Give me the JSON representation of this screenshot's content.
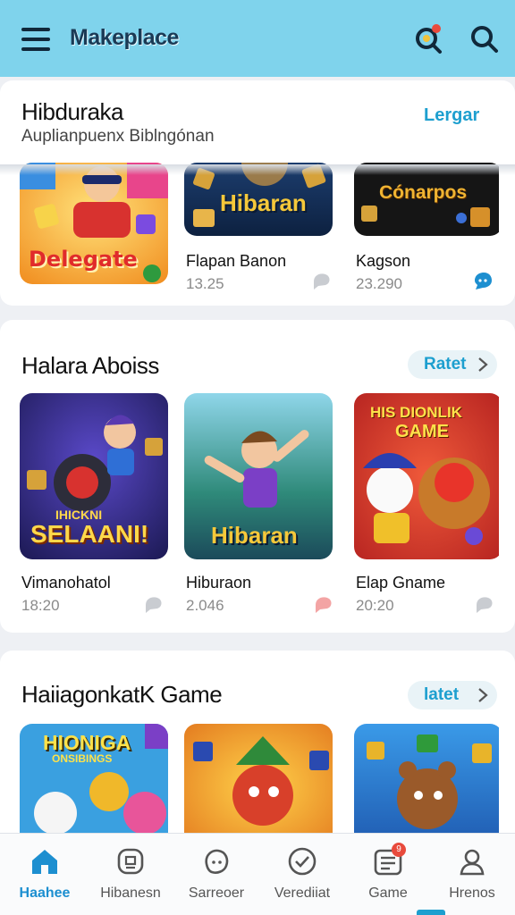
{
  "app": {
    "title": "Makeplace"
  },
  "colors": {
    "header": "#7fd3ec",
    "accent": "#1d9fcf",
    "nav_active": "#1d8fd0"
  },
  "header": {
    "icons": [
      "menu-icon",
      "filter-search-icon",
      "search-icon"
    ],
    "notification_dot_color": "#e84a3c"
  },
  "section1": {
    "title": "Hibduraka",
    "subtitle": "Auplianpuenx Biblngónan",
    "action": "Lergar",
    "items": [
      {
        "tile_text": "Delegate",
        "name": "",
        "value": ""
      },
      {
        "tile_text": "Hibaran",
        "name": "Flapan Banon",
        "value": "13.25"
      },
      {
        "tile_text": "Cónarpos",
        "name": "Kagson",
        "value": "23.290"
      }
    ]
  },
  "section2": {
    "title": "Halara Aboiss",
    "action": "Ratet",
    "items": [
      {
        "tile_text": "SELAANI!",
        "tile_text_top": "IHICKNI",
        "name": "Vimanohatol",
        "value": "18:20"
      },
      {
        "tile_text": "Hibaran",
        "name": "Hiburaon",
        "value": "2.046"
      },
      {
        "tile_text": "GAME",
        "tile_text_top": "HIS DIONLIK",
        "name": "Elap Gname",
        "value": "20:20"
      }
    ]
  },
  "section3": {
    "title": "HaiiagonkatK Game",
    "action": "latet",
    "items": [
      {
        "tile_text": "HIONIGA",
        "tile_text_sub": "ONSIBINGS",
        "name": "",
        "value": ""
      },
      {
        "tile_text": "",
        "name": "",
        "value": ""
      },
      {
        "tile_text": "",
        "name": "",
        "value": ""
      }
    ]
  },
  "bottom_nav": [
    {
      "label": "Haahee",
      "icon": "home-icon",
      "active": true
    },
    {
      "label": "Hibanesn",
      "icon": "controller-icon",
      "active": false
    },
    {
      "label": "Sarreoer",
      "icon": "face-icon",
      "active": false
    },
    {
      "label": "Verediiat",
      "icon": "check-circle-icon",
      "active": false
    },
    {
      "label": "Game",
      "icon": "game-list-icon",
      "active": false,
      "badge": "9"
    },
    {
      "label": "Hrenos",
      "icon": "person-icon",
      "active": false
    }
  ]
}
